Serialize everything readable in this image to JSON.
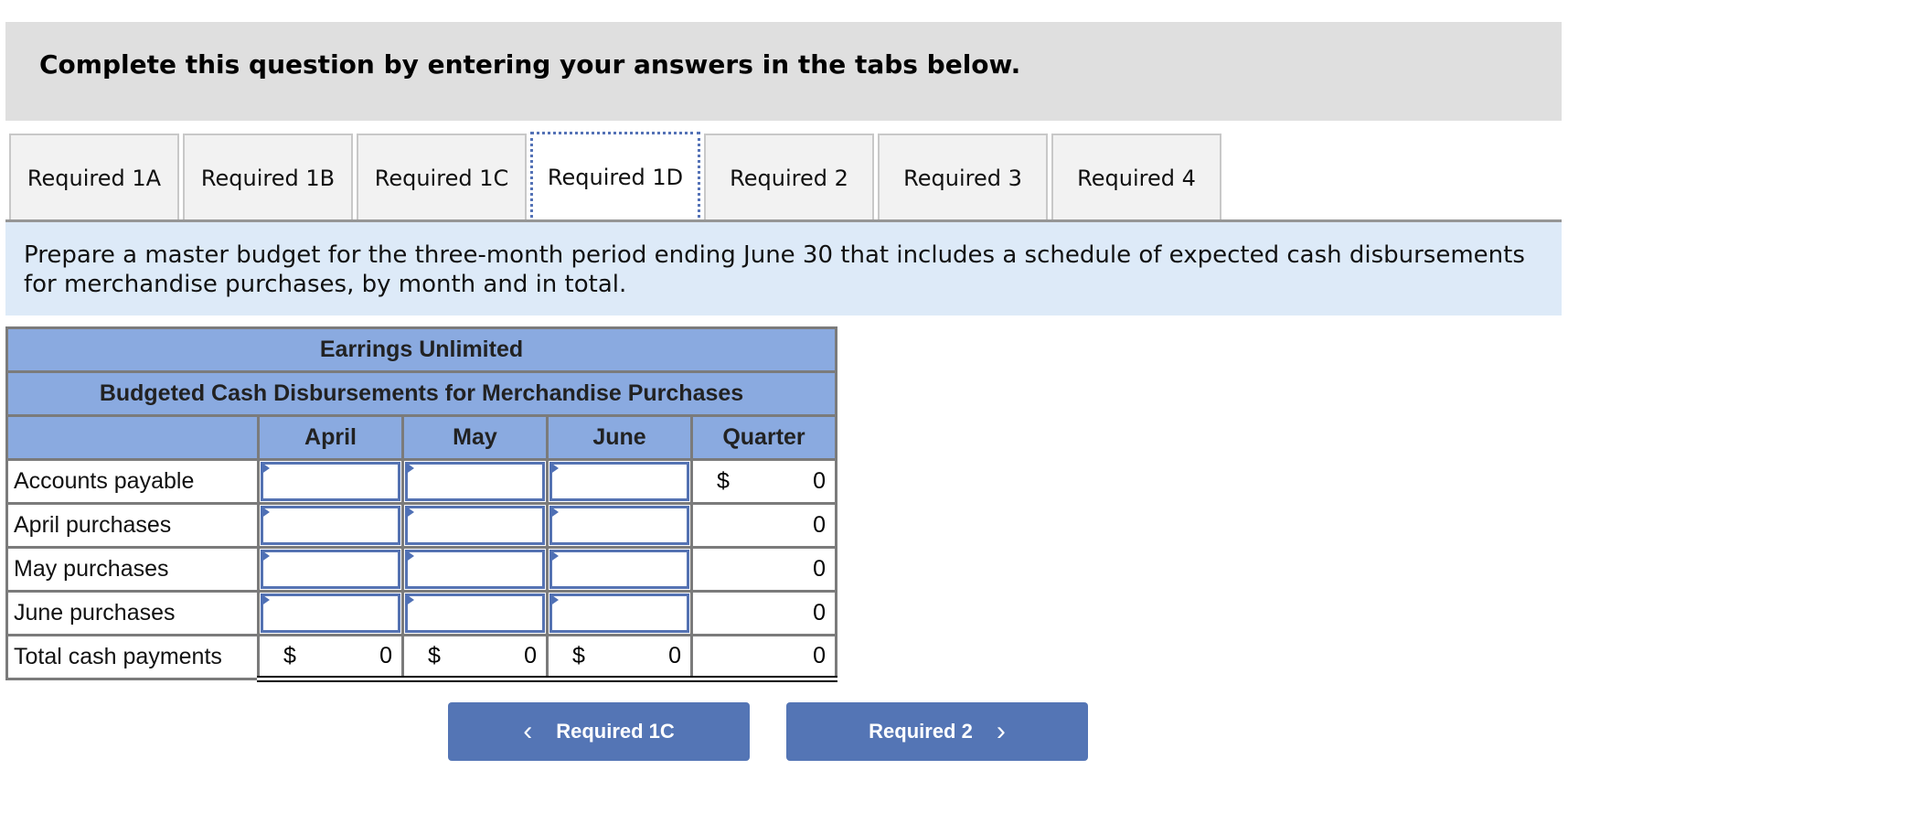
{
  "instructions": "Complete this question by entering your answers in the tabs below.",
  "tabs": [
    {
      "label": "Required 1A",
      "active": false
    },
    {
      "label": "Required 1B",
      "active": false
    },
    {
      "label": "Required 1C",
      "active": false
    },
    {
      "label": "Required 1D",
      "active": true
    },
    {
      "label": "Required 2",
      "active": false
    },
    {
      "label": "Required 3",
      "active": false
    },
    {
      "label": "Required 4",
      "active": false
    }
  ],
  "prompt": "Prepare a master budget for the three-month period ending June 30 that includes a schedule of expected cash disbursements for merchandise purchases, by month and in total.",
  "table": {
    "company": "Earrings Unlimited",
    "title": "Budgeted Cash Disbursements for Merchandise Purchases",
    "columns": [
      "April",
      "May",
      "June",
      "Quarter"
    ],
    "currency_symbol": "$",
    "rows": [
      {
        "label": "Accounts payable",
        "april": "",
        "may": "",
        "june": "",
        "quarter": "0"
      },
      {
        "label": "April purchases",
        "april": "",
        "may": "",
        "june": "",
        "quarter": "0"
      },
      {
        "label": "May purchases",
        "april": "",
        "may": "",
        "june": "",
        "quarter": "0"
      },
      {
        "label": "June purchases",
        "april": "",
        "may": "",
        "june": "",
        "quarter": "0"
      }
    ],
    "total": {
      "label": "Total cash payments",
      "april": "0",
      "may": "0",
      "june": "0",
      "quarter": "0"
    }
  },
  "nav": {
    "prev_label": "Required 1C",
    "next_label": "Required 2",
    "prev_icon": "chevron-left-icon",
    "next_icon": "chevron-right-icon"
  }
}
